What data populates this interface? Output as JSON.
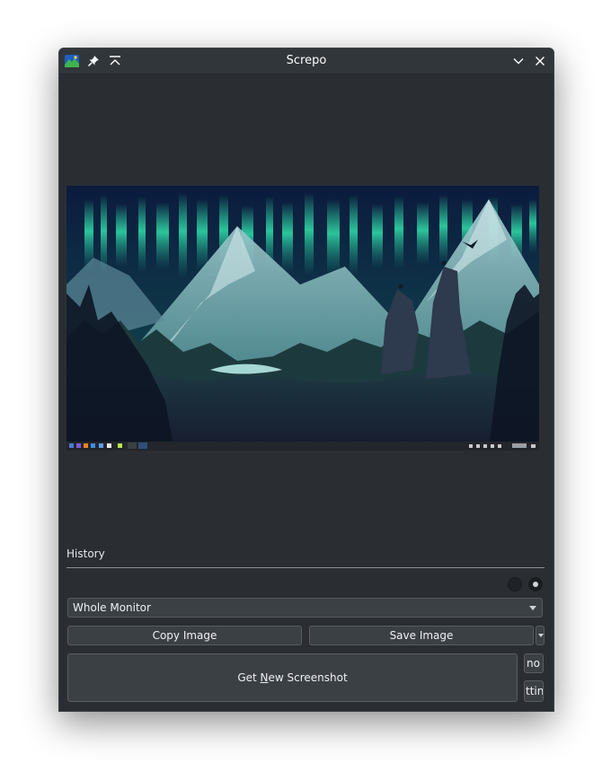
{
  "window": {
    "title": "Screpo"
  },
  "history": {
    "label": "History"
  },
  "capture_mode": {
    "selected": "Whole Monitor"
  },
  "actions": {
    "copy_label": "Copy Image",
    "save_label": "Save Image",
    "get_prefix": "Get ",
    "get_mnemonic": "N",
    "get_suffix": "ew Screenshot",
    "side_button_1": "no",
    "side_button_2": "ttin"
  },
  "icons": {
    "app": "screpo-app-icon",
    "pin": "pin-icon",
    "keep_above": "keep-above-icon",
    "minimize": "chevron-down-icon",
    "close": "close-icon"
  },
  "colors": {
    "accent_aurora": "#2fd6a6",
    "window_bg": "#2a2e32",
    "titlebar_bg": "#31363b"
  }
}
